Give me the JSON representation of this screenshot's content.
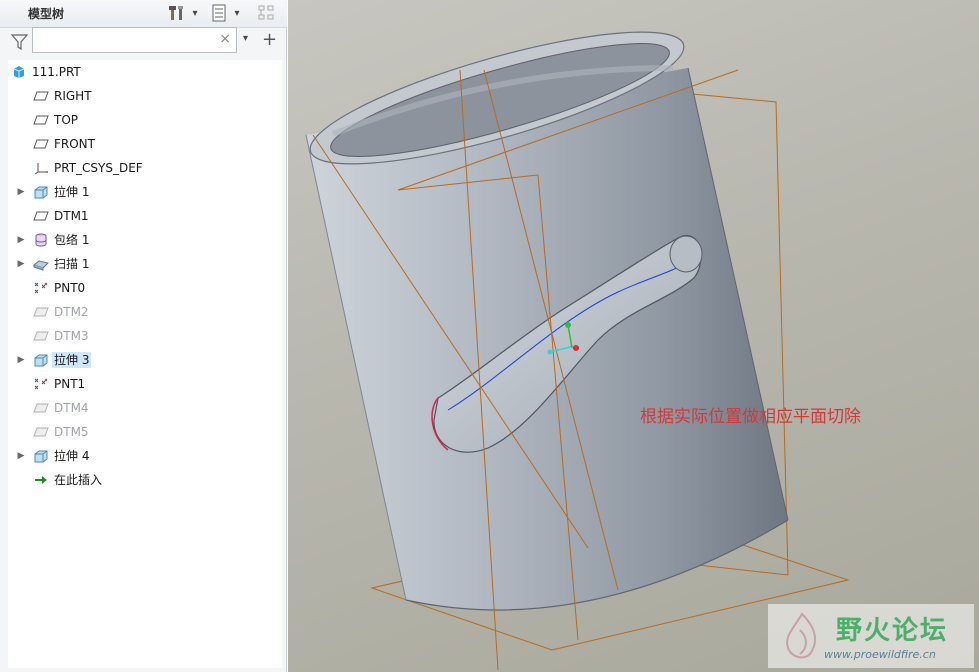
{
  "panel": {
    "title": "模型树",
    "search_placeholder": "",
    "search_value": "",
    "clear_symbol": "×",
    "add_symbol": "+",
    "dropdown_symbol": "▾"
  },
  "tree": [
    {
      "label": "111.PRT",
      "icon": "part-icon",
      "dim": false,
      "expander": false,
      "selected": false
    },
    {
      "label": "RIGHT",
      "icon": "datum-plane-icon",
      "dim": false,
      "expander": false,
      "selected": false
    },
    {
      "label": "TOP",
      "icon": "datum-plane-icon",
      "dim": false,
      "expander": false,
      "selected": false
    },
    {
      "label": "FRONT",
      "icon": "datum-plane-icon",
      "dim": false,
      "expander": false,
      "selected": false
    },
    {
      "label": "PRT_CSYS_DEF",
      "icon": "coordinate-system-icon",
      "dim": false,
      "expander": false,
      "selected": false
    },
    {
      "label": "拉伸 1",
      "icon": "extrude-icon",
      "dim": false,
      "expander": true,
      "selected": false
    },
    {
      "label": "DTM1",
      "icon": "datum-plane-icon",
      "dim": false,
      "expander": false,
      "selected": false
    },
    {
      "label": "包络 1",
      "icon": "wrap-icon",
      "dim": false,
      "expander": true,
      "selected": false
    },
    {
      "label": "扫描 1",
      "icon": "sweep-icon",
      "dim": false,
      "expander": true,
      "selected": false
    },
    {
      "label": "PNT0",
      "icon": "datum-point-icon",
      "dim": false,
      "expander": false,
      "selected": false
    },
    {
      "label": "DTM2",
      "icon": "datum-plane-icon",
      "dim": true,
      "expander": false,
      "selected": false
    },
    {
      "label": "DTM3",
      "icon": "datum-plane-icon",
      "dim": true,
      "expander": false,
      "selected": false
    },
    {
      "label": "拉伸 3",
      "icon": "extrude-icon",
      "dim": false,
      "expander": true,
      "selected": true
    },
    {
      "label": "PNT1",
      "icon": "datum-point-icon",
      "dim": false,
      "expander": false,
      "selected": false
    },
    {
      "label": "DTM4",
      "icon": "datum-plane-icon",
      "dim": true,
      "expander": false,
      "selected": false
    },
    {
      "label": "DTM5",
      "icon": "datum-plane-icon",
      "dim": true,
      "expander": false,
      "selected": false
    },
    {
      "label": "拉伸 4",
      "icon": "extrude-icon",
      "dim": false,
      "expander": true,
      "selected": false
    },
    {
      "label": "在此插入",
      "icon": "insert-here-arrow-icon",
      "dim": false,
      "expander": false,
      "selected": false
    }
  ],
  "viewport": {
    "annotation": "根据实际位置做相应平面切除",
    "watermark_title": "野火论坛",
    "watermark_url": "www.proewildfire.cn"
  },
  "colors": {
    "accent_selection": "#cfe7fb",
    "annotation_red": "#d23a3a",
    "datum_orange": "#b86a1e",
    "model_gray": "#9aa1ab",
    "curve_blue": "#1f3fd6",
    "watermark_green": "#4caf6a"
  }
}
